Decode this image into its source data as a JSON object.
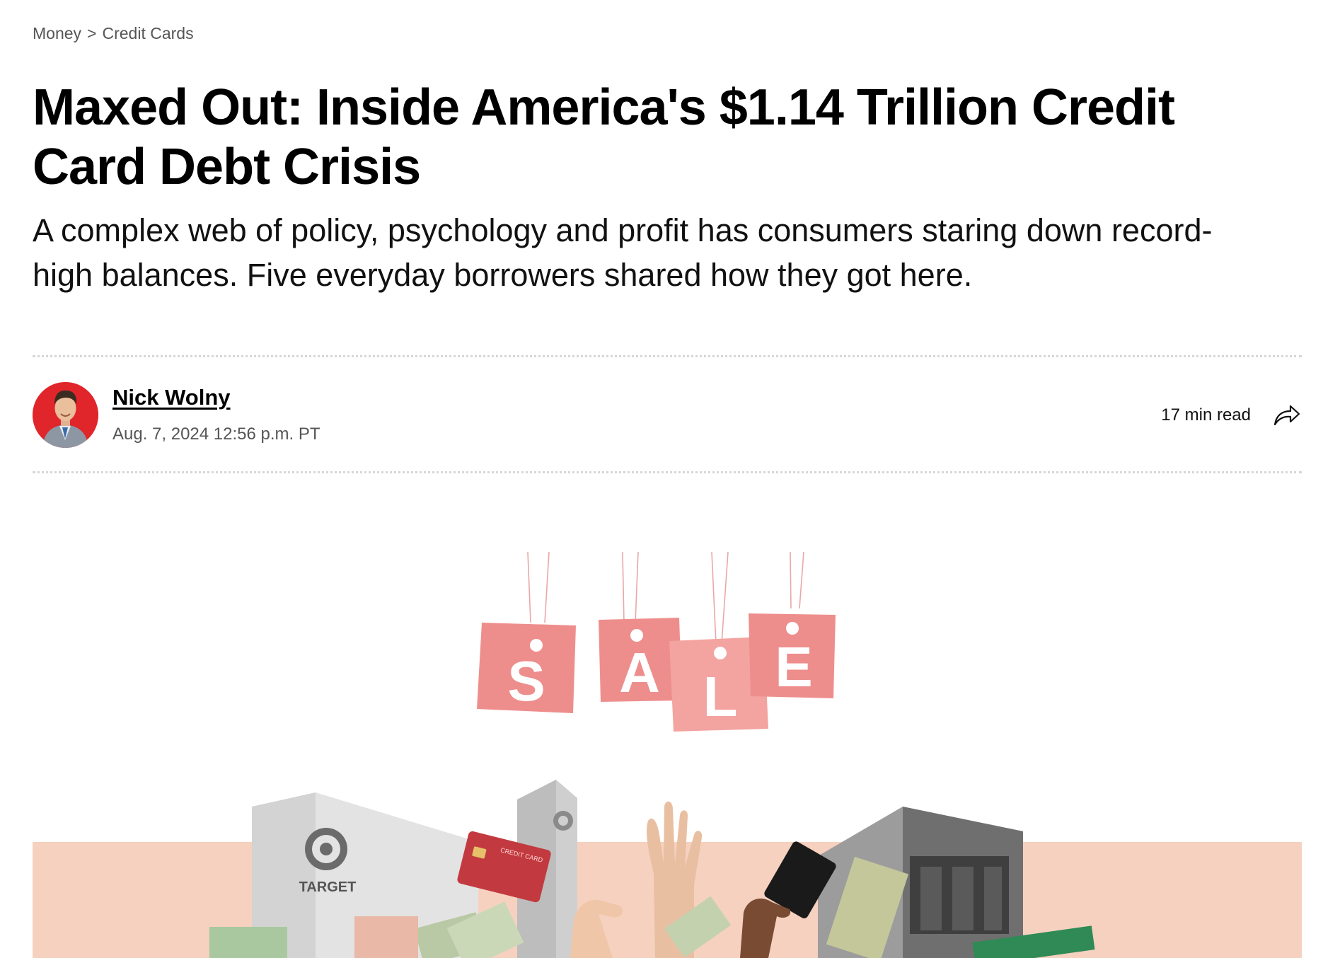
{
  "breadcrumb": {
    "section": "Money",
    "separator": ">",
    "subsection": "Credit Cards"
  },
  "article": {
    "title": "Maxed Out: Inside America's $1.14 Trillion Credit Card Debt Crisis",
    "dek": "A complex web of policy, psychology and profit has consumers staring down record-high balances. Five everyday borrowers shared how they got here."
  },
  "byline": {
    "author": "Nick Wolny",
    "date": "Aug. 7, 2024 12:56 p.m. PT",
    "read_time": "17 min read"
  },
  "hero": {
    "sale_letters": [
      "S",
      "A",
      "L",
      "E"
    ],
    "store_sign": "TARGET",
    "card_label": "CREDIT CARD"
  },
  "colors": {
    "accent_red": "#e0252b",
    "sale_tag": "#ee8e8c",
    "backdrop": "#f6d1bf"
  }
}
